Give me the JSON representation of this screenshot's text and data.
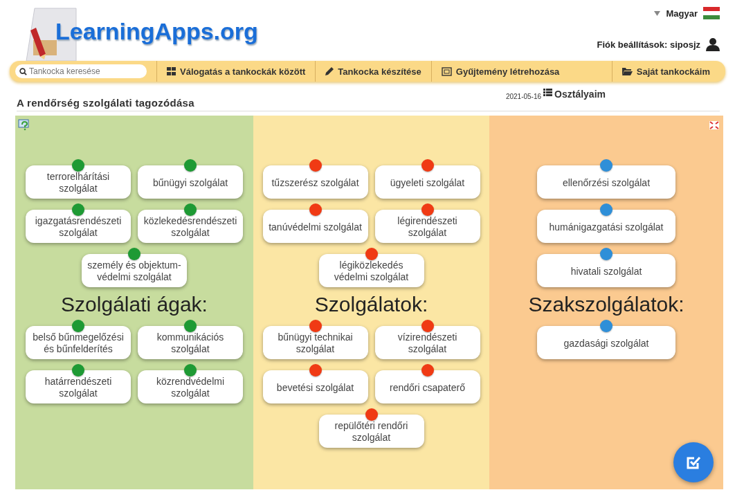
{
  "header": {
    "logo": "LearningApps.org",
    "language": "Magyar",
    "account": "Fiók beállítások: siposjz"
  },
  "nav": {
    "search": {
      "placeholder": "Tankocka keresése"
    },
    "items": [
      {
        "label": "Válogatás a tankockák között"
      },
      {
        "label": "Tankocka készítése"
      },
      {
        "label": "Gyűjtemény létrehozása"
      },
      {
        "label": "Saját tankockáim"
      }
    ]
  },
  "title": "A rendőrség szolgálati tagozódása",
  "date": "2021-05-16",
  "classes_link": "Osztályaim",
  "columns": [
    {
      "heading": "Szolgálati ágak:",
      "cards_above": [
        {
          "text": "terrorelhárítási szolgálat",
          "color": "#1e9a34"
        },
        {
          "text": "bűnügyi szolgálat",
          "color": "#1e9a34"
        },
        {
          "text": "igazgatásrendészeti szolgálat",
          "color": "#1e9a34"
        },
        {
          "text": "közlekedésrendészeti szolgálat",
          "color": "#1e9a34"
        },
        {
          "text": "személy és objektum-védelmi szolgálat",
          "color": "#1e9a34"
        }
      ],
      "cards_below": [
        {
          "text": "belső bűnmegelőzési és bűnfelderítés",
          "color": "#1e9a34"
        },
        {
          "text": "kommunikációs szolgálat",
          "color": "#1e9a34"
        },
        {
          "text": "határrendészeti szolgálat",
          "color": "#1e9a34"
        },
        {
          "text": "közrendvédelmi szolgálat",
          "color": "#1e9a34"
        }
      ]
    },
    {
      "heading": "Szolgálatok:",
      "cards_above": [
        {
          "text": "tűzszerész szolgálat",
          "color": "#f03a14"
        },
        {
          "text": "ügyeleti szolgálat",
          "color": "#f03a14"
        },
        {
          "text": "tanúvédelmi szolgálat",
          "color": "#f03a14"
        },
        {
          "text": "légirendészeti szolgálat",
          "color": "#f03a14"
        },
        {
          "text": "légiközlekedés védelmi szolgálat",
          "color": "#f03a14"
        }
      ],
      "cards_below": [
        {
          "text": "bűnügyi technikai szolgálat",
          "color": "#f03a14"
        },
        {
          "text": "vízirendészeti szolgálat",
          "color": "#f03a14"
        },
        {
          "text": "bevetési szolgálat",
          "color": "#f03a14"
        },
        {
          "text": "rendőri csapaterő",
          "color": "#f03a14"
        },
        {
          "text": "repülőtéri rendőri szolgálat",
          "color": "#f03a14"
        }
      ]
    },
    {
      "heading": "Szakszolgálatok:",
      "cards_above": [
        {
          "text": "ellenőrzési szolgálat",
          "color": "#2f8fd8"
        },
        {
          "text": "humánigazgatási szolgálat",
          "color": "#2f8fd8"
        },
        {
          "text": "hivatali szolgálat",
          "color": "#2f8fd8"
        }
      ],
      "cards_below": [
        {
          "text": "gazdasági szolgálat",
          "color": "#2f8fd8"
        }
      ]
    }
  ]
}
